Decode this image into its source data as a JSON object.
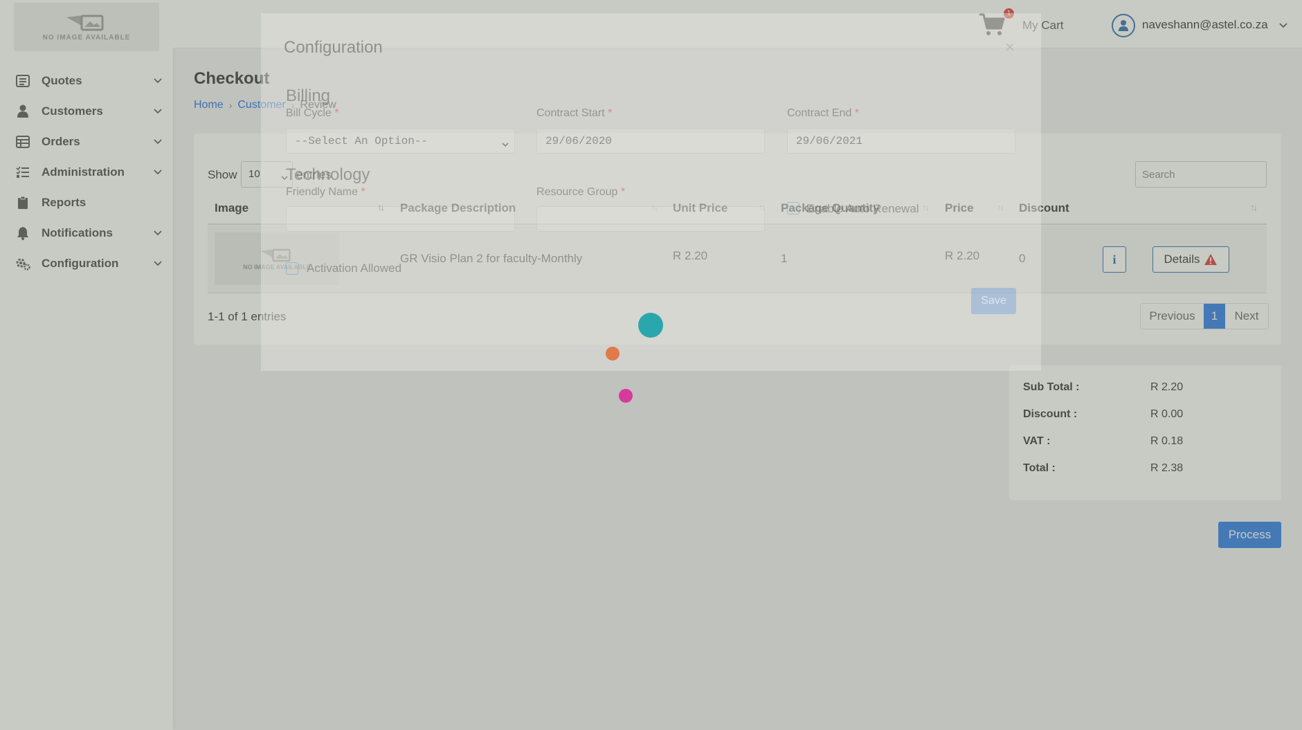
{
  "sidebar": {
    "logo_text": "NO IMAGE AVAILABLE",
    "items": [
      {
        "label": "Quotes",
        "icon": "list-icon",
        "has_children": true
      },
      {
        "label": "Customers",
        "icon": "person-icon",
        "has_children": true
      },
      {
        "label": "Orders",
        "icon": "table-icon",
        "has_children": true
      },
      {
        "label": "Administration",
        "icon": "tasks-icon",
        "has_children": true
      },
      {
        "label": "Reports",
        "icon": "clipboard-icon",
        "has_children": false
      },
      {
        "label": "Notifications",
        "icon": "bell-icon",
        "has_children": true
      },
      {
        "label": "Configuration",
        "icon": "gears-icon",
        "has_children": true
      }
    ]
  },
  "header": {
    "cart_count": "1",
    "cart_label": "My Cart",
    "user_email": "naveshann@astel.co.za"
  },
  "page": {
    "title": "Checkout",
    "breadcrumb": [
      "Home",
      "Customer",
      "Review"
    ]
  },
  "table": {
    "show_label": "Show",
    "page_size": "10",
    "entries_label": "entries",
    "search_placeholder": "Search",
    "columns": [
      "Image",
      "Package Description",
      "Unit Price",
      "Package Quantity",
      "Price",
      "Discount"
    ],
    "rows": [
      {
        "image_text": "NO IMAGE AVAILABLE",
        "description": "GR Visio Plan 2 for faculty-Monthly",
        "unit_price": "R 2.20",
        "quantity": "1",
        "price": "R 2.20",
        "discount": "0",
        "info_label": "i",
        "details_label": "Details"
      }
    ],
    "count_text": "1-1 of 1 entries",
    "pagination": {
      "previous": "Previous",
      "current": "1",
      "next": "Next"
    }
  },
  "totals": {
    "sub_total_label": "Sub Total :",
    "sub_total": "R 2.20",
    "discount_label": "Discount :",
    "discount": "R 0.00",
    "vat_label": "VAT :",
    "vat": "R 0.18",
    "total_label": "Total :",
    "total": "R 2.38"
  },
  "process_label": "Process",
  "modal": {
    "title": "Configuration",
    "close": "×",
    "billing_heading": "Billing",
    "bill_cycle_label": "Bill Cycle",
    "bill_cycle_value": "--Select An Option--",
    "contract_start_label": "Contract Start",
    "contract_start_value": "29/06/2020",
    "contract_end_label": "Contract End",
    "contract_end_value": "29/06/2021",
    "technology_heading": "Technology",
    "friendly_name_label": "Friendly Name",
    "resource_group_label": "Resource Group",
    "auto_renewal_label": "Enable Auto Renewal",
    "activation_label": "Activation Allowed",
    "save_label": "Save",
    "required_mark": "*"
  },
  "colors": {
    "accent": "#2b7de9",
    "loader_dot_1": "#2aa7ad",
    "loader_dot_2": "#e07a4a",
    "loader_dot_3": "#d63a9a",
    "warning": "#e53935"
  }
}
